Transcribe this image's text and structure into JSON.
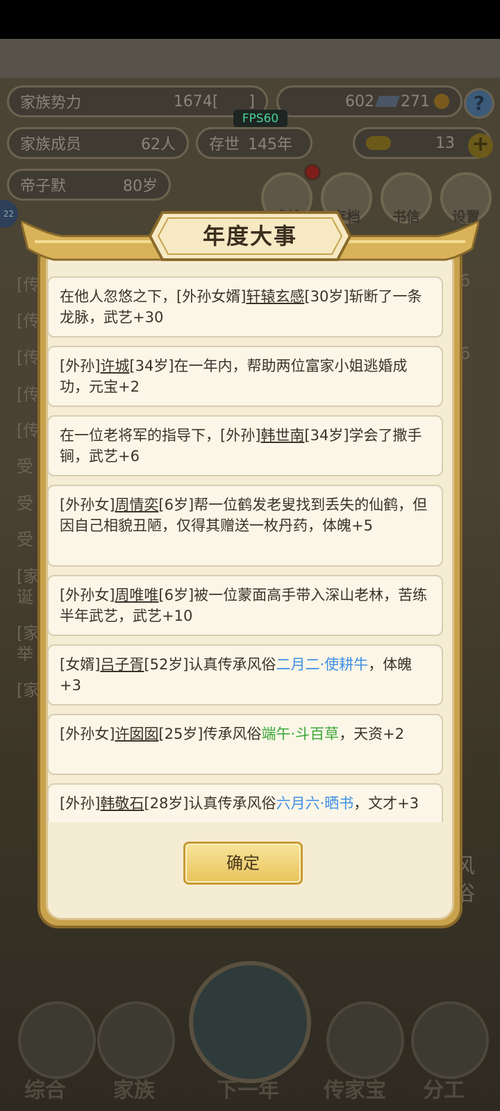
{
  "hud": {
    "family_power_label": "家族势力",
    "family_power_value": "1674",
    "bracket_left": "[",
    "bracket_right": "]",
    "currency_a": "602",
    "currency_b": "271",
    "family_members_label": "家族成员",
    "family_members_value": "62人",
    "existence_label": "存世",
    "existence_value": "145年",
    "gold_value": "13",
    "emperor_label": "帝子默",
    "emperor_age": "80岁",
    "fps": "FPS60",
    "side_badge": "22"
  },
  "menu_buttons": [
    {
      "label": "成就"
    },
    {
      "label": "存档"
    },
    {
      "label": "书信"
    },
    {
      "label": "设置"
    }
  ],
  "background_left_text": [
    "[传",
    "[传",
    "[传",
    "[传",
    "[传",
    "受",
    "受",
    "受",
    "[家",
    "诞",
    "[家",
    "举",
    "[家"
  ],
  "background_right_text": [
    "6",
    "6",
    "风",
    "俗"
  ],
  "dialog": {
    "title": "年度大事",
    "confirm_label": "确定",
    "events": [
      {
        "parts": [
          {
            "t": "在他人忽悠之下，[外孙女婿]"
          },
          {
            "t": "轩辕玄感",
            "c": "name"
          },
          {
            "t": "[30岁]斩断了一条龙脉，武艺+30"
          }
        ]
      },
      {
        "parts": [
          {
            "t": "[外孙]"
          },
          {
            "t": "许城",
            "c": "name"
          },
          {
            "t": "[34岁]在一年内，帮助两位富家小姐逃婚成功，元宝+2"
          }
        ]
      },
      {
        "parts": [
          {
            "t": "在一位老将军的指导下，[外孙]"
          },
          {
            "t": "韩世南",
            "c": "name"
          },
          {
            "t": "[34岁]学会了撒手锏，武艺+6"
          }
        ]
      },
      {
        "parts": [
          {
            "t": "[外孙女]"
          },
          {
            "t": "周情奕",
            "c": "name"
          },
          {
            "t": "[6岁]帮一位鹤发老叟找到丢失的仙鹤，但因自己相貌丑陋，仅得其赠送一枚丹药，体魄+5"
          }
        ]
      },
      {
        "parts": [
          {
            "t": "[外孙女]"
          },
          {
            "t": "周唯唯",
            "c": "name"
          },
          {
            "t": "[6岁]被一位蒙面高手带入深山老林，苦练半年武艺，武艺+10"
          }
        ]
      },
      {
        "parts": [
          {
            "t": "[女婿]"
          },
          {
            "t": "吕子胥",
            "c": "name"
          },
          {
            "t": "[52岁]认真传承风俗"
          },
          {
            "t": "二月二·使耕牛",
            "c": "blue"
          },
          {
            "t": "，体魄+3"
          }
        ]
      },
      {
        "parts": [
          {
            "t": "[外孙女]"
          },
          {
            "t": "许囡囡",
            "c": "name"
          },
          {
            "t": "[25岁]传承风俗"
          },
          {
            "t": "端午·斗百草",
            "c": "green"
          },
          {
            "t": "，天资+2"
          }
        ]
      },
      {
        "parts": [
          {
            "t": "[外孙]"
          },
          {
            "t": "韩敬石",
            "c": "name"
          },
          {
            "t": "[28岁]认真传承风俗"
          },
          {
            "t": "六月六·晒书",
            "c": "blue"
          },
          {
            "t": "，文才+3"
          }
        ]
      }
    ]
  },
  "bottom_nav": [
    {
      "label": "综合"
    },
    {
      "label": "家族"
    },
    {
      "label": "下一年"
    },
    {
      "label": "传家宝"
    },
    {
      "label": "分工"
    }
  ]
}
